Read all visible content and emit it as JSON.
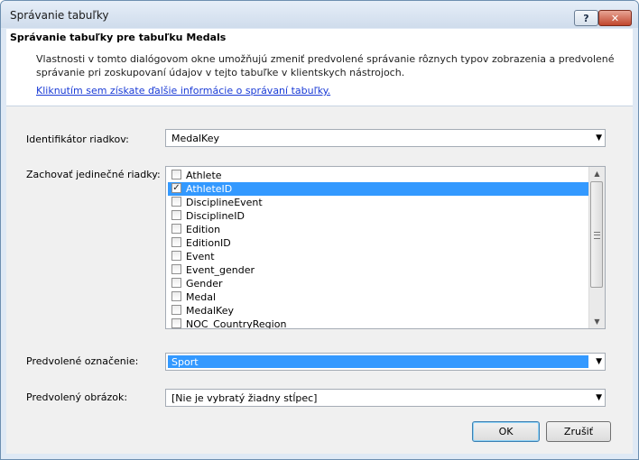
{
  "window": {
    "title": "Správanie tabuľky",
    "help_glyph": "?",
    "close_glyph": "✕"
  },
  "header": {
    "title": "Správanie tabuľky pre tabuľku Medals",
    "description": "Vlastnosti v tomto dialógovom okne umožňujú zmeniť predvolené správanie rôznych typov zobrazenia a predvolené správanie pri zoskupovaní údajov v tejto tabuľke v klientskych nástrojoch.",
    "link": "Kliknutím sem získate ďalšie informácie o správaní tabuľky."
  },
  "form": {
    "row_identifier": {
      "label": "Identifikátor riadkov:",
      "value": "MedalKey"
    },
    "keep_unique": {
      "label": "Zachovať jedinečné riadky:",
      "items": [
        {
          "label": "Athlete",
          "checked": false,
          "selected": false
        },
        {
          "label": "AthleteID",
          "checked": true,
          "selected": true
        },
        {
          "label": "DisciplineEvent",
          "checked": false,
          "selected": false
        },
        {
          "label": "DisciplineID",
          "checked": false,
          "selected": false
        },
        {
          "label": "Edition",
          "checked": false,
          "selected": false
        },
        {
          "label": "EditionID",
          "checked": false,
          "selected": false
        },
        {
          "label": "Event",
          "checked": false,
          "selected": false
        },
        {
          "label": "Event_gender",
          "checked": false,
          "selected": false
        },
        {
          "label": "Gender",
          "checked": false,
          "selected": false
        },
        {
          "label": "Medal",
          "checked": false,
          "selected": false
        },
        {
          "label": "MedalKey",
          "checked": false,
          "selected": false
        },
        {
          "label": "NOC_CountryRegion",
          "checked": false,
          "selected": false
        }
      ]
    },
    "default_label": {
      "label": "Predvolené označenie:",
      "value": "Sport"
    },
    "default_image": {
      "label": "Predvolený obrázok:",
      "value": "[Nie je vybratý žiadny stĺpec]"
    }
  },
  "buttons": {
    "ok": "OK",
    "cancel": "Zrušiť"
  },
  "icons": {
    "dropdown": "chevron-down-icon",
    "check": "checkmark-icon"
  },
  "colors": {
    "selection": "#3399ff",
    "link": "#1a3bd6"
  }
}
